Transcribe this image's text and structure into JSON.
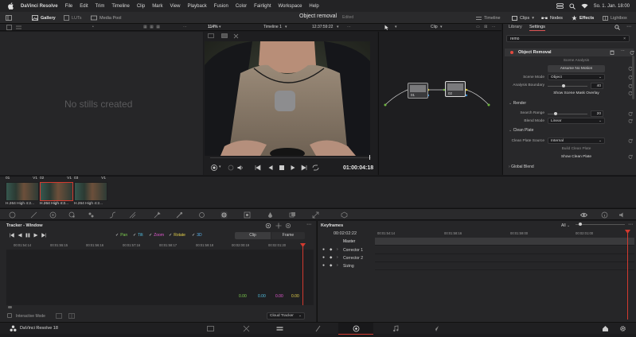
{
  "menubar": {
    "items": [
      "DaVinci Resolve",
      "File",
      "Edit",
      "Trim",
      "Timeline",
      "Clip",
      "Mark",
      "View",
      "Playback",
      "Fusion",
      "Color",
      "Fairlight",
      "Workspace",
      "Help"
    ],
    "datetime": "So. 1. Jan. 18:00"
  },
  "toolbar": {
    "gallery": "Gallery",
    "luts": "LUTs",
    "media_pool": "Media Pool",
    "project_title": "Object removal",
    "edited": "Edited",
    "timeline": "Timeline",
    "clips": "Clips",
    "nodes": "Nodes",
    "effects": "Effects",
    "lightbox": "Lightbox"
  },
  "viewer_strip": {
    "zoom": "114%",
    "timeline_name": "Timeline 1",
    "timecode_top": "12:37:59:22",
    "clip_mode": "Clip"
  },
  "gallery": {
    "empty_text": "No stills created"
  },
  "viewer": {
    "timecode": "01:00:04:18"
  },
  "nodes": {
    "node1": "01",
    "node2": "02"
  },
  "inspector": {
    "tabs": [
      "Library",
      "Settings"
    ],
    "selected_tab": "Settings",
    "search_value": "remo",
    "effect_title": "Object Removal",
    "scene_analysis_label": "Scene Analysis",
    "assume_no_motion": "Assume No Motion",
    "scene_mode_label": "Scene Mode",
    "scene_mode_value": "Object",
    "analysis_boundary_label": "Analysis Boundary",
    "analysis_boundary_value": "40",
    "analysis_boundary_level": 0.4,
    "show_scene_mask_overlay": "Show Scene Mask Overlay",
    "render_section": "Render",
    "search_range_label": "Search Range",
    "search_range_value": "20",
    "search_range_level": 0.2,
    "blend_mode_label": "Blend Mode",
    "blend_mode_value": "Linear",
    "clean_plate_section": "Clean Plate",
    "clean_plate_source_label": "Clean Plate Source",
    "clean_plate_source_value": "Internal",
    "build_clean_plate": "Build Clean Plate",
    "show_clean_plate": "Show Clean Plate",
    "global_blend_section": "Global Blend"
  },
  "clips": [
    {
      "num": "01",
      "track": "V1",
      "name": "H.264 High 4:2..."
    },
    {
      "num": "02",
      "track": "V1",
      "name": "H.264 High 4:2..."
    },
    {
      "num": "03",
      "track": "V1",
      "name": "H.264 High 4:2..."
    }
  ],
  "tracker": {
    "title": "Tracker - Window",
    "checks": [
      "Pan",
      "Tilt",
      "Zoom",
      "Rotate",
      "3D"
    ],
    "check_colors": [
      "#7fd14f",
      "#53c3e6",
      "#e65ad4",
      "#e6d24a",
      "#5ab4f0"
    ],
    "clip_tab": "Clip",
    "frame_tab": "Frame",
    "ruler": [
      "00:01:54:14",
      "00:01:55:15",
      "00:01:56:16",
      "00:01:57:16",
      "00:01:58:17",
      "00:01:59:18",
      "00:02:00:19",
      "00:02:01:20"
    ],
    "values": [
      "0.00",
      "0.00",
      "0.00",
      "0.00"
    ],
    "value_colors": [
      "#7fd14f",
      "#53c3e6",
      "#e65ad4",
      "#e6d24a"
    ],
    "interactive_mode": "Interactive Mode",
    "cloud_tracker": "Cloud Tracker"
  },
  "keyframes": {
    "title": "Keyframes",
    "filter": "All",
    "timecode": "00:02:02:22",
    "ruler": [
      "00:01:54:14",
      "00:01:58:16",
      "00:01:59:00",
      "00:02:01:00"
    ],
    "master": "Master",
    "rows": [
      "Corrector 1",
      "Corrector 2",
      "Sizing"
    ]
  },
  "pagebar": {
    "app_name": "DaVinci Resolve 18"
  },
  "colors": {
    "accent_red": "#e34a3f",
    "playhead": "#d33a2f",
    "selected_page": "#d33a2f"
  }
}
